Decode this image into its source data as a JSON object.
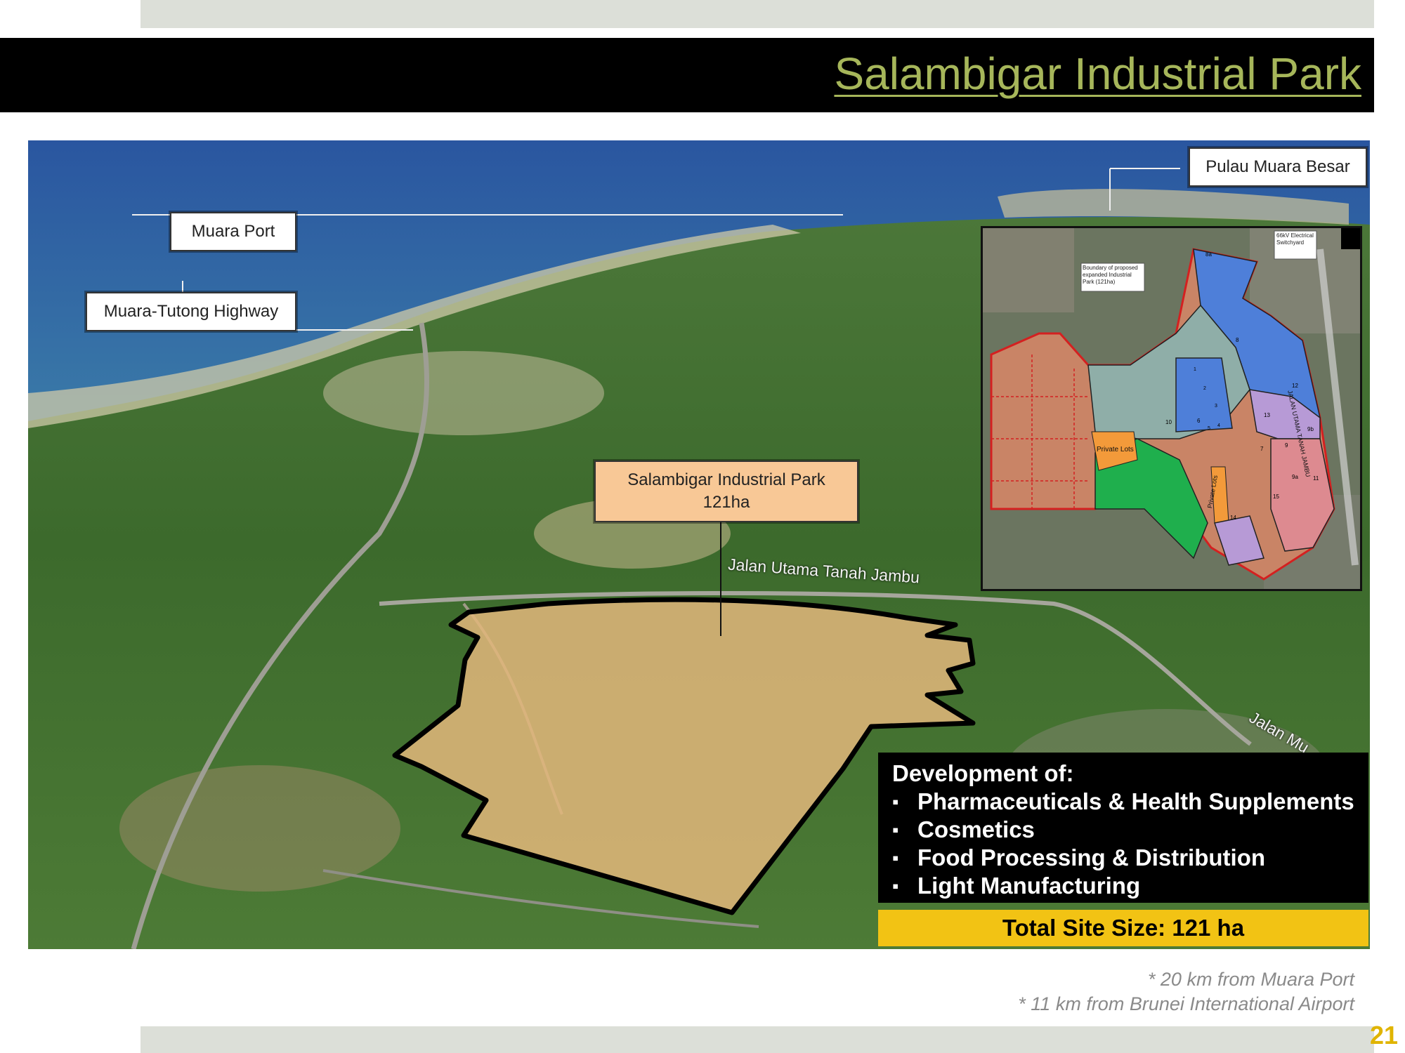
{
  "slide": {
    "title": "Salambigar Industrial Park",
    "page_number": "21"
  },
  "map": {
    "callouts": {
      "muara_port": "Muara Port",
      "highway": "Muara-Tutong Highway",
      "pulau": "Pulau Muara Besar",
      "park_name": "Salambigar Industrial Park",
      "park_area": "121ha"
    },
    "road_labels": {
      "jalan_utama": "Jalan Utama Tanah Jambu",
      "jalan_muara": "Jalan Mu"
    },
    "inset": {
      "boundary_note": "Boundary of proposed expanded Industrial Park (121ha)",
      "switchyard": "66kV Electrical Switchyard",
      "road": "JALAN UTAMA TANAH JAMBU",
      "private_lots_1": "Private Lots",
      "private_lots_2": "Private Lots",
      "lots": [
        "8a",
        "8",
        "12",
        "13",
        "9b",
        "9",
        "9a",
        "11",
        "10",
        "6",
        "7",
        "15",
        "14",
        "1",
        "2",
        "3",
        "4",
        "5"
      ]
    },
    "colors": {
      "park_fill": "#e3b77b",
      "sea": "#2d5fa0",
      "vegetation": "#3e6b2a",
      "title": "#a6b65a",
      "highlight_yellow": "#f2c314"
    }
  },
  "development": {
    "heading": "Development of:",
    "items": [
      "Pharmaceuticals & Health Supplements",
      "Cosmetics",
      "Food Processing & Distribution",
      "Light Manufacturing"
    ],
    "total_site_size": "Total Site Size: 121 ha"
  },
  "notes": [
    "* 20 km from Muara Port",
    "* 11 km from Brunei International Airport"
  ]
}
